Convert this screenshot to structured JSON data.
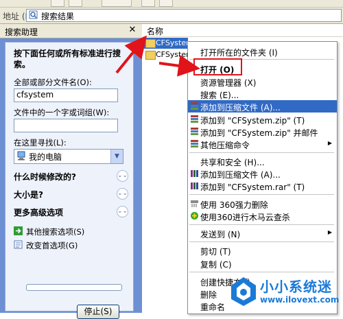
{
  "addressbar": {
    "label": "地址 (D)",
    "path": "搜索结果"
  },
  "search_pane": {
    "title": "搜索助理",
    "instruction": "按下面任何或所有标准进行搜索。",
    "filename_label": "全部或部分文件名(O):",
    "filename_value": "cfsystem",
    "phrase_label": "文件中的一个字或词组(W):",
    "phrase_value": "",
    "lookin_label": "在这里寻找(L):",
    "lookin_value": "我的电脑",
    "sections": [
      "什么时候修改的?",
      "大小是?",
      "更多高级选项"
    ],
    "links": [
      "其他搜索选项(S)",
      "改变首选项(G)"
    ],
    "progress": 0,
    "stop_label": "停止(S)"
  },
  "list": {
    "column_name": "名称",
    "files": [
      "CFSystem",
      "CFSystem"
    ]
  },
  "context_menu": {
    "items": [
      {
        "label": "打开所在的文件夹 (I)"
      },
      {
        "label": "打开 (O)"
      },
      {
        "label": "资源管理器 (X)"
      },
      {
        "label": "搜索 (E)..."
      },
      {
        "label": "添加到压缩文件 (A)..."
      },
      {
        "label": "添加到 \"CFSystem.zip\" (T)"
      },
      {
        "label": "添加到 \"CFSystem.zip\" 并邮件"
      },
      {
        "label": "其他压缩命令"
      },
      {
        "label": "共享和安全 (H)..."
      },
      {
        "label": "添加到压缩文件 (A)..."
      },
      {
        "label": "添加到 \"CFSystem.rar\" (T)"
      },
      {
        "label": "使用 360强力删除"
      },
      {
        "label": "使用360进行木马云查杀"
      },
      {
        "label": "发送到 (N)"
      },
      {
        "label": "剪切 (T)"
      },
      {
        "label": "复制 (C)"
      },
      {
        "label": "创建快捷方式"
      },
      {
        "label": "删除"
      },
      {
        "label": "重命名"
      }
    ]
  },
  "watermark": {
    "logo_text": "小小系统迷",
    "url": "www.ilovext.com"
  },
  "colors": {
    "highlight": "#316ac5",
    "annotation": "#e0141a",
    "pane_blue": "#6d8fd3"
  }
}
